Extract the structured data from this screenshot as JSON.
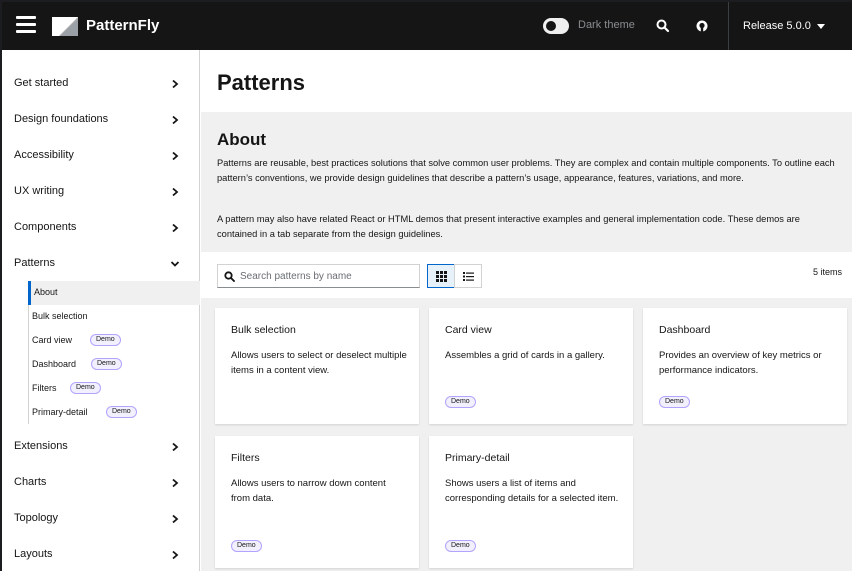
{
  "masthead": {
    "brand": "PatternFly",
    "dark_theme_label": "Dark theme",
    "release_label": "Release 5.0.0"
  },
  "sidebar": {
    "items": [
      {
        "label": "Get started",
        "expanded": false
      },
      {
        "label": "Design foundations",
        "expanded": false
      },
      {
        "label": "Accessibility",
        "expanded": false
      },
      {
        "label": "UX writing",
        "expanded": false
      },
      {
        "label": "Components",
        "expanded": false
      },
      {
        "label": "Patterns",
        "expanded": true
      },
      {
        "label": "Extensions",
        "expanded": false
      },
      {
        "label": "Charts",
        "expanded": false
      },
      {
        "label": "Topology",
        "expanded": false
      },
      {
        "label": "Layouts",
        "expanded": false
      }
    ],
    "sub_items": [
      {
        "label": "About",
        "active": true,
        "badge": ""
      },
      {
        "label": "Bulk selection",
        "active": false,
        "badge": ""
      },
      {
        "label": "Card view",
        "active": false,
        "badge": "Demo"
      },
      {
        "label": "Dashboard",
        "active": false,
        "badge": "Demo"
      },
      {
        "label": "Filters",
        "active": false,
        "badge": "Demo"
      },
      {
        "label": "Primary-detail",
        "active": false,
        "badge": "Demo"
      }
    ]
  },
  "main": {
    "title": "Patterns",
    "about": {
      "heading": "About",
      "p1": "Patterns are reusable, best practices solutions that solve common user problems. They are complex and contain multiple components. To outline each pattern’s conventions, we provide design guidelines that describe a pattern’s usage, appearance, features, variations, and more.",
      "p2": "A pattern may also have related React or HTML demos that present interactive examples and general implementation code. These demos are contained in a tab separate from the design guidelines."
    },
    "toolbar": {
      "search_placeholder": "Search patterns by name",
      "search_value": "",
      "item_count": "5 items",
      "selected_view": "grid"
    },
    "cards": [
      {
        "title": "Bulk selection",
        "body": "Allows users to select or deselect multiple items in a content view.",
        "badge": ""
      },
      {
        "title": "Card view",
        "body": "Assembles a grid of cards in a gallery.",
        "badge": "Demo"
      },
      {
        "title": "Dashboard",
        "body": "Provides an overview of key metrics or performance indicators.",
        "badge": "Demo"
      },
      {
        "title": "Filters",
        "body": "Allows users to narrow down content from data.",
        "badge": "Demo"
      },
      {
        "title": "Primary-detail",
        "body": "Shows users a list of items and corresponding details for a selected item.",
        "badge": "Demo"
      }
    ]
  },
  "colors": {
    "masthead_bg": "#151515",
    "active_accent": "#0066cc",
    "badge_border": "#b2a3ff",
    "page_bg": "#f0f0f0"
  },
  "icons": [
    "hamburger-icon",
    "patternfly-logo",
    "search-icon",
    "github-icon",
    "caret-down-icon",
    "chevron-right-icon",
    "chevron-down-icon",
    "grid-view-icon",
    "list-view-icon"
  ]
}
